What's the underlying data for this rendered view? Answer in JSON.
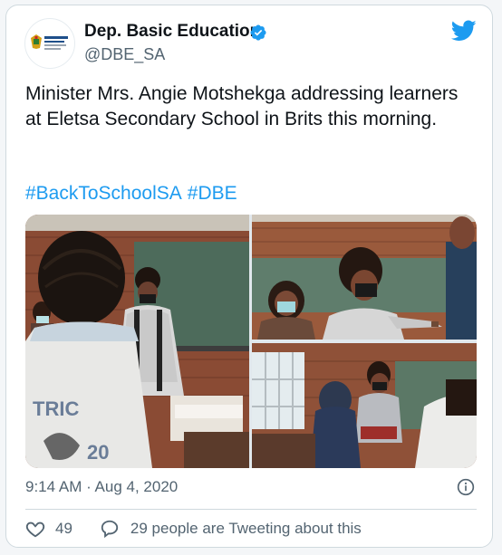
{
  "tweet": {
    "author_name": "Dep. Basic Education",
    "author_handle": "@DBE_SA",
    "verified": true,
    "avatar_text": "basic education",
    "text": "Minister Mrs. Angie Motshekga addressing learners at Eletsa Secondary School in Brits this morning.",
    "hashtags": [
      "#BackToSchoolSA",
      "#DBE"
    ],
    "photo_jersey_text": "TRIC",
    "photo_jersey_number": "20",
    "timestamp": "9:14 AM · Aug 4, 2020",
    "likes": "49",
    "reply_text": "29 people are Tweeting about this"
  },
  "colors": {
    "accent": "#1d9bf0",
    "text": "#0f1419",
    "muted": "#536471",
    "border": "#cfd9de"
  },
  "icons": [
    "twitter-bird-icon",
    "verified-badge-icon",
    "info-icon",
    "heart-icon",
    "reply-bubble-icon"
  ]
}
